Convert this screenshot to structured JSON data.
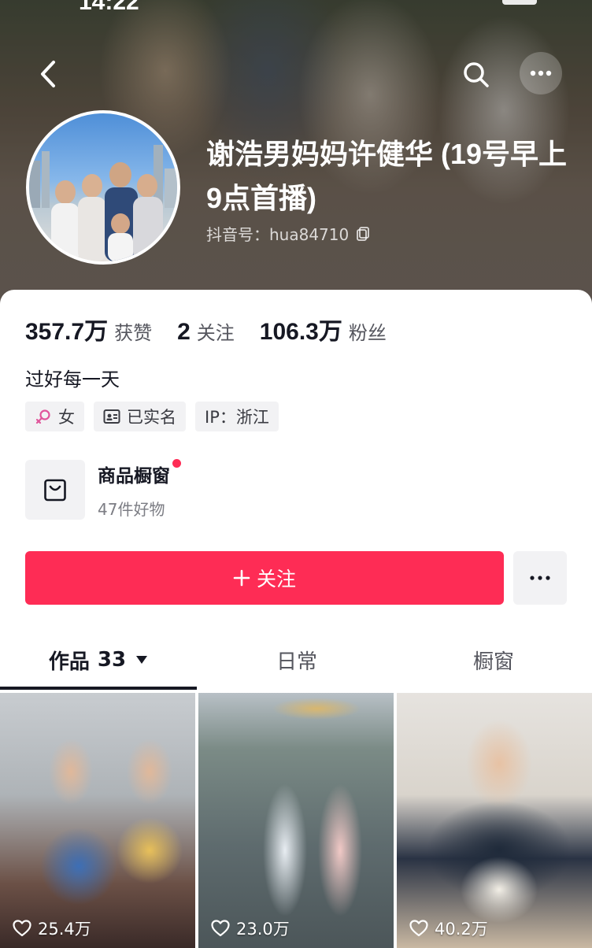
{
  "status_bar": {
    "time": "14:22"
  },
  "profile": {
    "name": "谢浩男妈妈许健华 (19号早上9点首播)",
    "douyin_id": "抖音号：hua84710",
    "bio": "过好每一天"
  },
  "stats": [
    {
      "value": "357.7万",
      "label": "获赞"
    },
    {
      "value": "2",
      "label": "关注"
    },
    {
      "value": "106.3万",
      "label": "粉丝"
    }
  ],
  "tags": {
    "gender": "女",
    "verified": "已实名",
    "ip": "IP：浙江"
  },
  "shop": {
    "title": "商品橱窗",
    "subtitle": "47件好物"
  },
  "actions": {
    "follow_label": "关注"
  },
  "tabs": [
    {
      "label": "作品",
      "count": "33"
    },
    {
      "label": "日常"
    },
    {
      "label": "橱窗"
    }
  ],
  "videos": [
    {
      "likes": "25.4万"
    },
    {
      "likes": "23.0万"
    },
    {
      "likes": "40.2万"
    }
  ],
  "colors": {
    "accent": "#fe2c55",
    "text_primary": "#161823",
    "chip_bg": "#f2f2f4",
    "gender_icon": "#e0559b"
  },
  "icons": {
    "back": "chevron-left-icon",
    "search": "search-icon",
    "more": "more-dots-icon",
    "copy": "copy-icon",
    "gender": "female-icon",
    "verified": "id-card-icon",
    "shop": "shopping-bag-icon",
    "caret": "caret-down-icon",
    "like": "heart-icon"
  }
}
